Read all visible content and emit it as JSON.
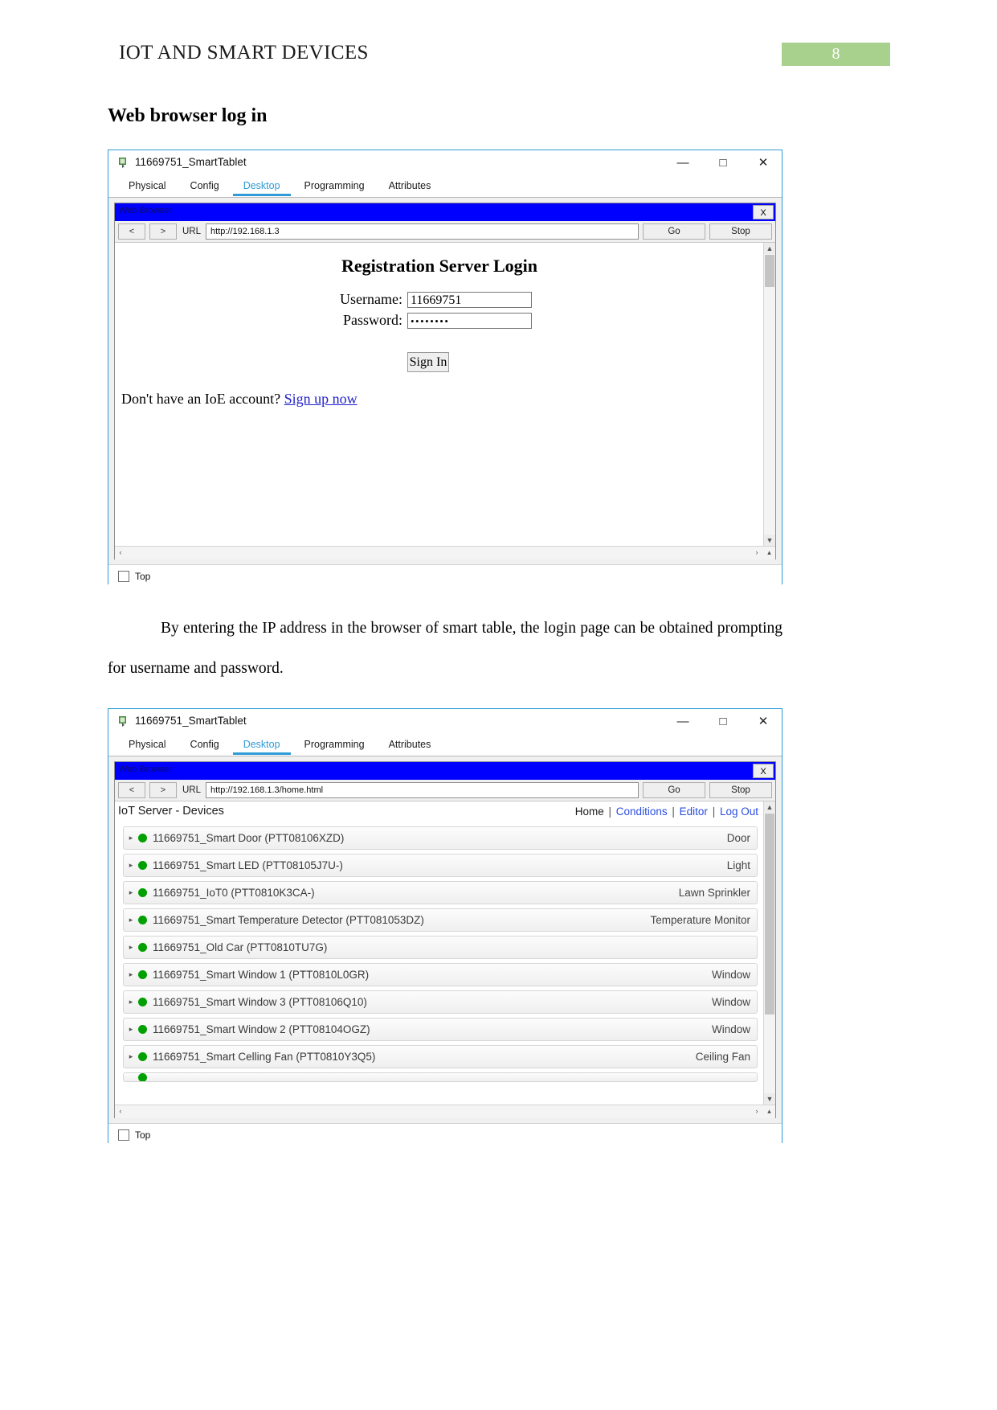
{
  "document": {
    "header_title": "IOT AND SMART DEVICES",
    "page_number": "8",
    "page_badge_color": "#a9d18e",
    "section_heading": "Web browser log in",
    "paragraph": "By entering the IP address in the browser of smart table, the login page can be obtained prompting for username and password."
  },
  "window1": {
    "title": "11669751_SmartTablet",
    "icon": "packet-tracer-icon",
    "minimize": "—",
    "maximize": "□",
    "close": "✕",
    "tabs": [
      {
        "label": "Physical",
        "active": false
      },
      {
        "label": "Config",
        "active": false
      },
      {
        "label": "Desktop",
        "active": true
      },
      {
        "label": "Programming",
        "active": false
      },
      {
        "label": "Attributes",
        "active": false
      }
    ],
    "browser": {
      "window_title": "Web Browser",
      "close_label": "X",
      "back_label": "<",
      "forward_label": ">",
      "url_label": "URL",
      "url_value": "http://192.168.1.3",
      "go_label": "Go",
      "stop_label": "Stop",
      "scroll_up": "▲",
      "scroll_down": "▼",
      "scroll_left": "‹",
      "scroll_right": "›",
      "scroll_corner": "▴"
    },
    "login": {
      "title": "Registration Server Login",
      "username_label": "Username:",
      "username_value": "11669751",
      "password_label": "Password:",
      "password_value": "••••••••",
      "signin_label": "Sign In",
      "signup_prompt": "Don't have an IoE account?",
      "signup_link": "Sign up now"
    },
    "footer_checkbox_label": "Top"
  },
  "window2": {
    "title": "11669751_SmartTablet",
    "icon": "packet-tracer-icon",
    "minimize": "—",
    "maximize": "□",
    "close": "✕",
    "tabs": [
      {
        "label": "Physical",
        "active": false
      },
      {
        "label": "Config",
        "active": false
      },
      {
        "label": "Desktop",
        "active": true
      },
      {
        "label": "Programming",
        "active": false
      },
      {
        "label": "Attributes",
        "active": false
      }
    ],
    "browser": {
      "window_title": "Web Browser",
      "close_label": "X",
      "back_label": "<",
      "forward_label": ">",
      "url_label": "URL",
      "url_value": "http://192.168.1.3/home.html",
      "go_label": "Go",
      "stop_label": "Stop",
      "scroll_up": "▲",
      "scroll_down": "▼",
      "scroll_left": "‹",
      "scroll_right": "›",
      "scroll_corner": "▴"
    },
    "iot": {
      "brand": "IoT Server - Devices",
      "nav": [
        {
          "label": "Home",
          "link": false
        },
        {
          "label": "Conditions",
          "link": true
        },
        {
          "label": "Editor",
          "link": true
        },
        {
          "label": "Log Out",
          "link": true
        }
      ],
      "nav_separator": "|",
      "collapse_caret": "⌃",
      "row_caret": "▸",
      "led_color": "#00a000",
      "devices": [
        {
          "name": "11669751_Smart Door (PTT08106XZD)",
          "type": "Door"
        },
        {
          "name": "11669751_Smart LED (PTT08105J7U-)",
          "type": "Light"
        },
        {
          "name": "11669751_IoT0 (PTT0810K3CA-)",
          "type": "Lawn Sprinkler"
        },
        {
          "name": "11669751_Smart Temperature Detector (PTT081053DZ)",
          "type": "Temperature Monitor"
        },
        {
          "name": "11669751_Old Car (PTT0810TU7G)",
          "type": ""
        },
        {
          "name": "11669751_Smart Window 1 (PTT0810L0GR)",
          "type": "Window"
        },
        {
          "name": "11669751_Smart Window 3 (PTT08106Q10)",
          "type": "Window"
        },
        {
          "name": "11669751_Smart Window 2 (PTT08104OGZ)",
          "type": "Window"
        },
        {
          "name": "11669751_Smart Celling Fan (PTT0810Y3Q5)",
          "type": "Ceiling Fan"
        }
      ]
    },
    "footer_checkbox_label": "Top"
  }
}
